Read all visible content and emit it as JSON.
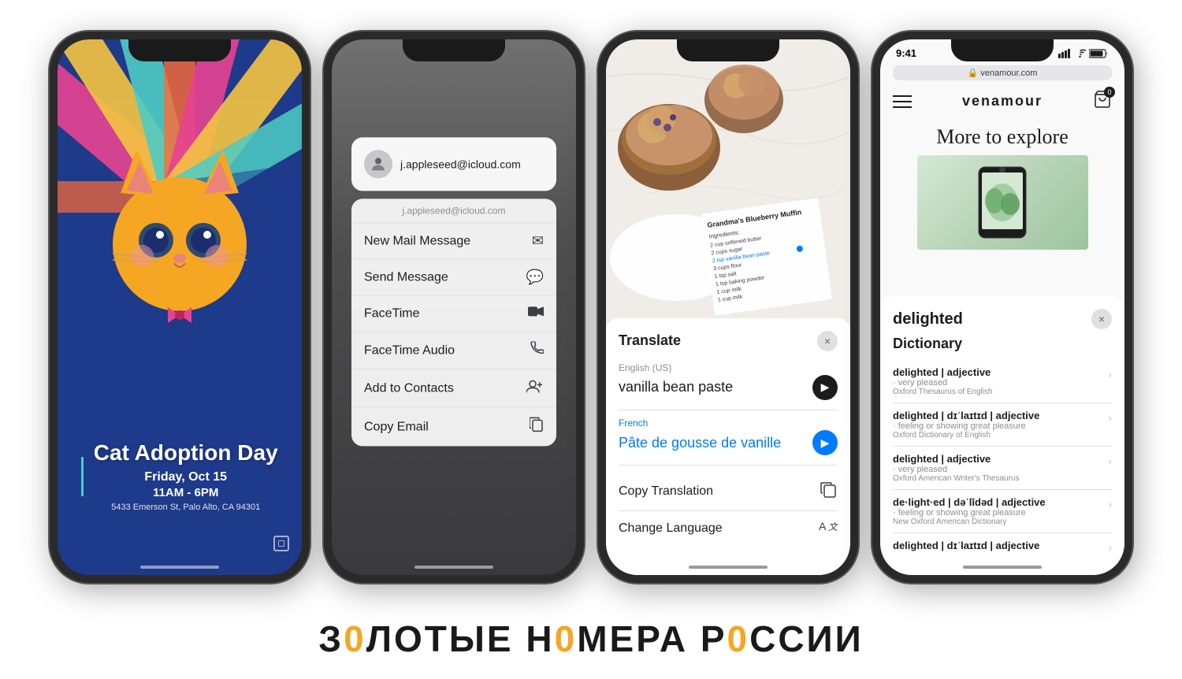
{
  "phones": {
    "phone1": {
      "event_title": "Cat Adoption Day",
      "event_date": "Friday, Oct 15",
      "event_time": "11AM - 6PM",
      "event_address": "5433 Emerson St, Palo Alto, CA 94301"
    },
    "phone2": {
      "email": "j.appleseed@icloud.com",
      "email_label": "j.appleseed@icloud.com",
      "menu_items": [
        {
          "label": "New Mail Message",
          "icon": "✉"
        },
        {
          "label": "Send Message",
          "icon": "💬"
        },
        {
          "label": "FaceTime",
          "icon": "📹"
        },
        {
          "label": "FaceTime Audio",
          "icon": "📞"
        },
        {
          "label": "Add to Contacts",
          "icon": "👤+"
        },
        {
          "label": "Copy Email",
          "icon": "📋"
        }
      ]
    },
    "phone3": {
      "panel_title": "Translate",
      "source_lang": "English (US)",
      "source_text": "vanilla bean paste",
      "target_lang": "French",
      "target_text": "Pâte de gousse de vanille",
      "action1": "Copy Translation",
      "action2": "Change Language",
      "recipe_title": "Grandma's Blueberry Muffin",
      "recipe_ingredients": "Ingredients:\n2 cups softened butter\n2 cups sugar\n2 tsp vanilla bean paste\n3 cups flour\n1 tsp salt\n1 tsp baking powder\n1 cup milk"
    },
    "phone4": {
      "status_time": "9:41",
      "url": "venamour.com",
      "logo": "venamour",
      "page_heading": "More to explore",
      "word": "delighted",
      "dict_section": "Dictionary",
      "entries": [
        {
          "title": "delighted | adjective",
          "sub": "· very pleased",
          "source": "Oxford Thesaurus of English"
        },
        {
          "title": "delighted | dɪˈlaɪtɪd | adjective",
          "sub": "· feeling or showing great pleasure",
          "source": "Oxford Dictionary of English"
        },
        {
          "title": "delighted | adjective",
          "sub": "· very pleased",
          "source": "Oxford American Writer's Thesaurus"
        },
        {
          "title": "de·light·ed | dəˈlīdəd | adjective",
          "sub": "· feeling or showing great pleasure",
          "source": "New Oxford American Dictionary"
        },
        {
          "title": "delighted | dɪˈlaɪtɪd | adjective",
          "sub": "",
          "source": ""
        }
      ]
    }
  },
  "bottom_text": {
    "part1": "З",
    "part2": "0",
    "part3": "ЛОТЫЕ Н",
    "part4": "0",
    "part5": "МЕРА Р",
    "part6": "0",
    "part7": "ССИИ"
  }
}
